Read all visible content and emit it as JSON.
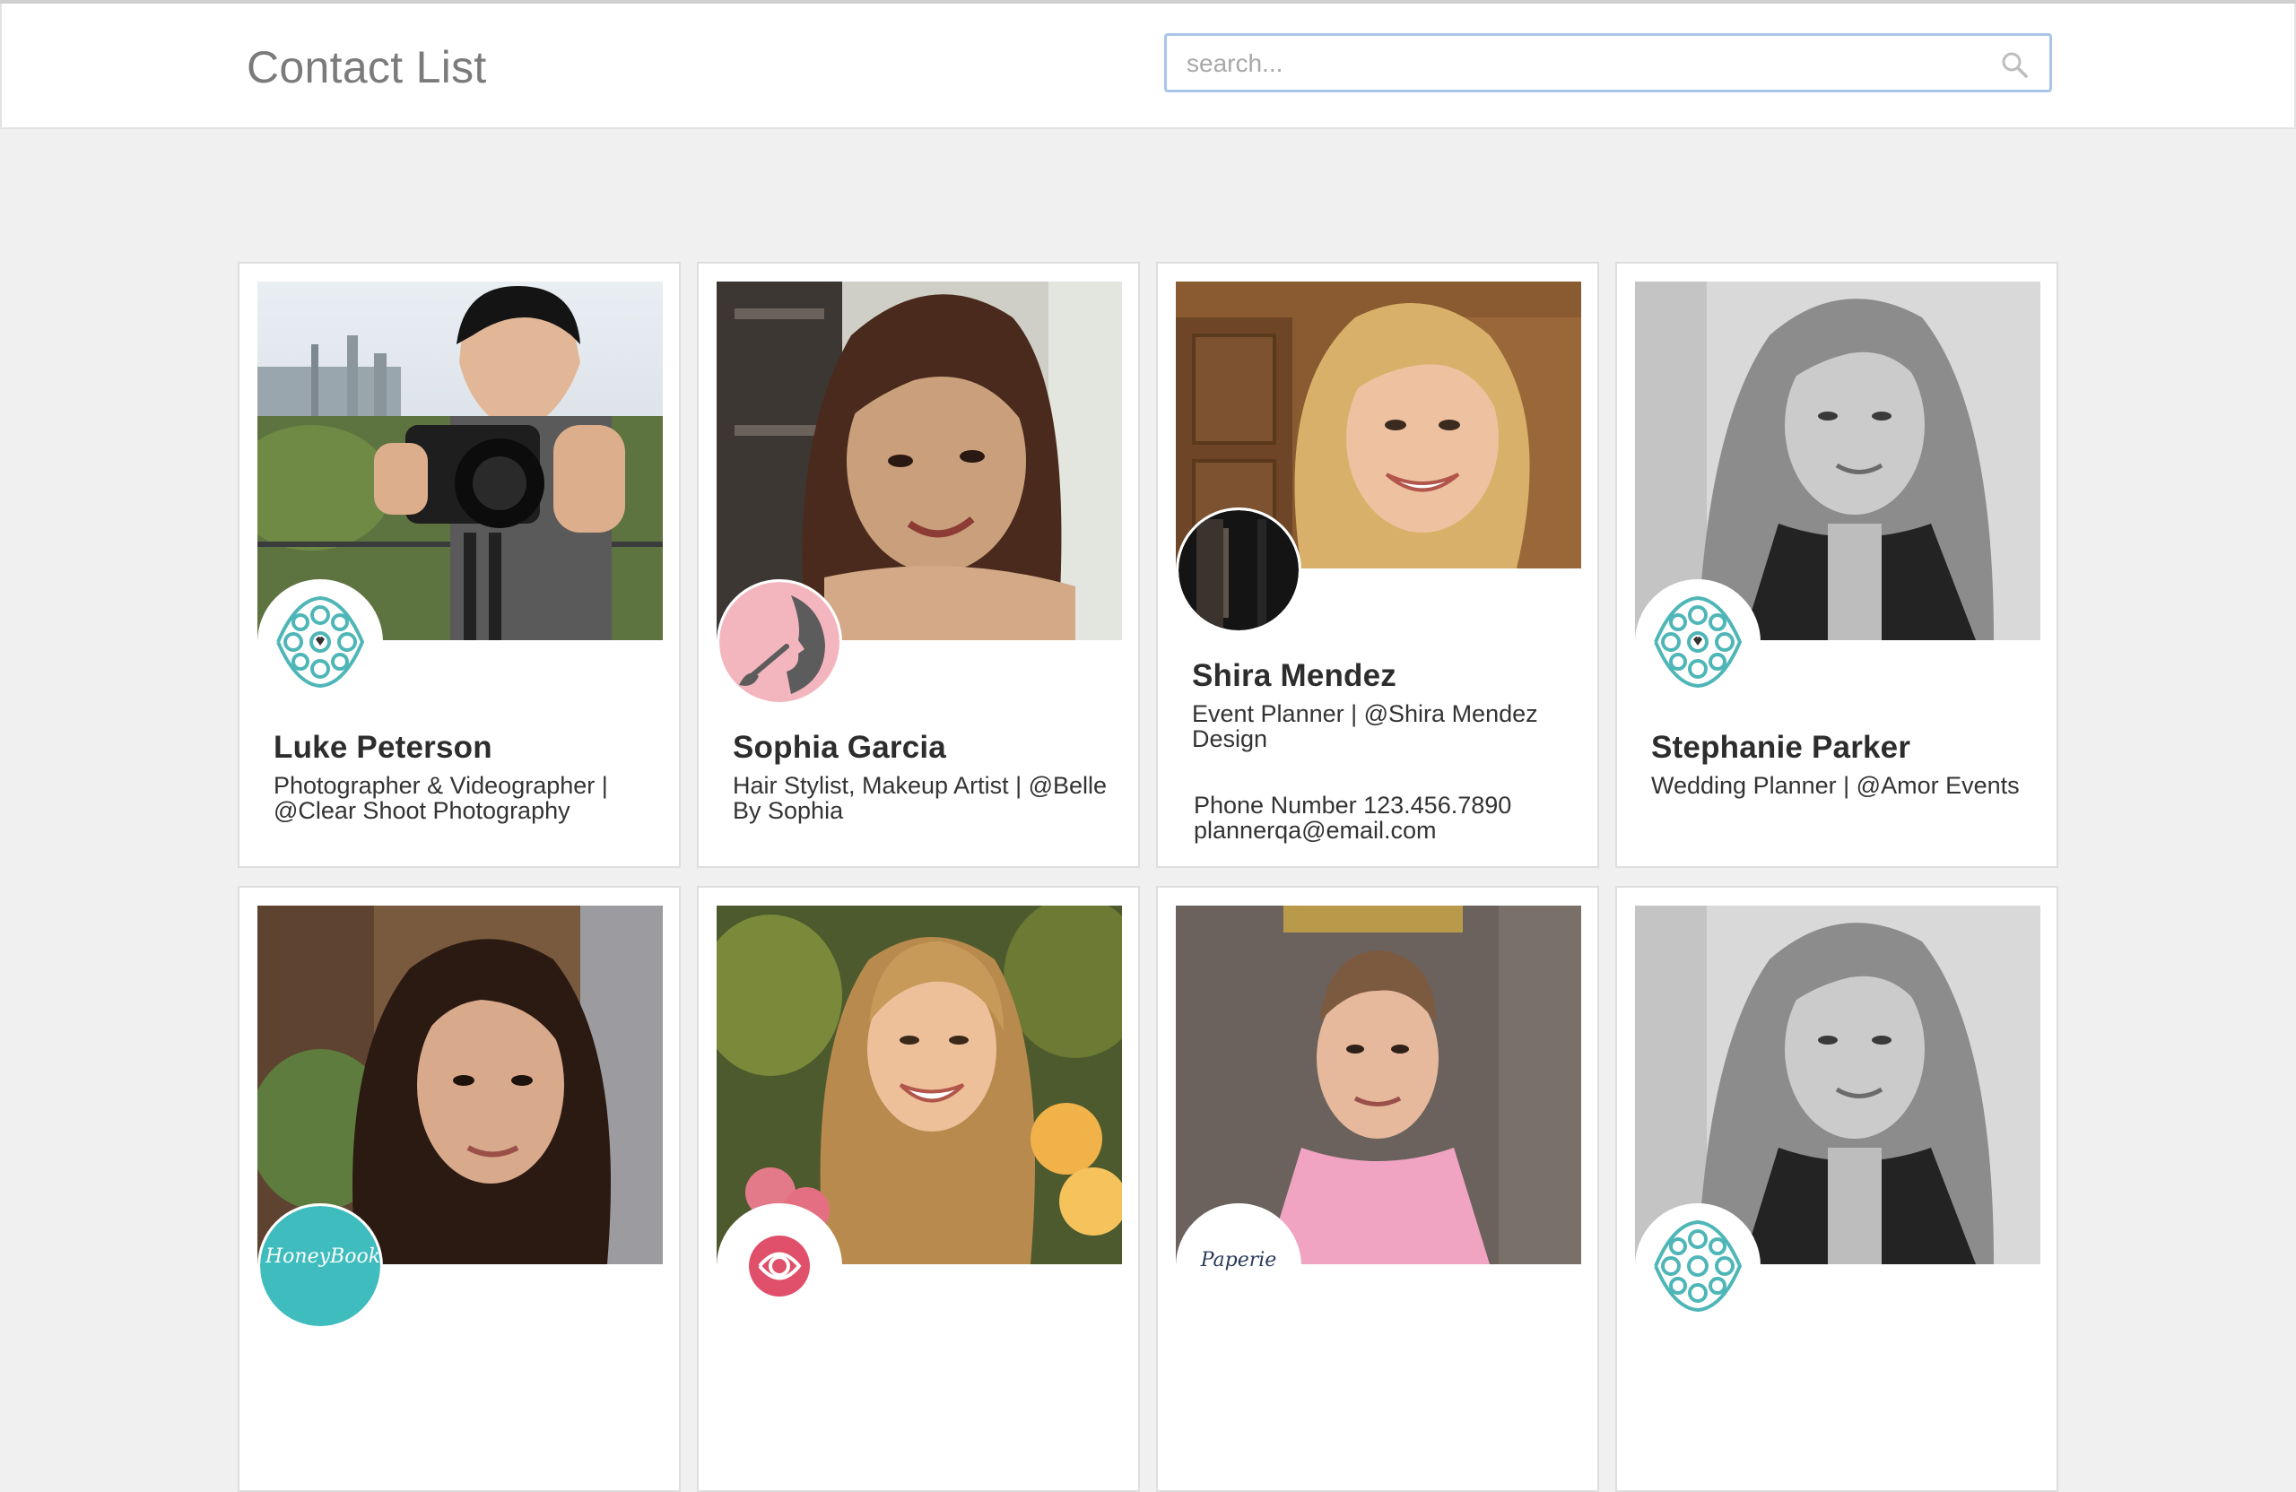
{
  "header": {
    "title": "Contact List",
    "search_placeholder": "search..."
  },
  "contacts": [
    {
      "name": "Luke Peterson",
      "role": "Photographer & Videographer | @Clear Shoot Photography",
      "logo": "teal-floral-logo"
    },
    {
      "name": "Sophia Garcia",
      "role": "Hair Stylist, Makeup Artist | @Belle By Sophia",
      "logo": "pink-makeup-logo"
    },
    {
      "name": "Shira Mendez",
      "role": "Event Planner | @Shira Mendez Design",
      "phone": "Phone Number 123.456.7890",
      "email": "plannerqa@email.com",
      "logo": "dark-door-logo"
    },
    {
      "name": "Stephanie Parker",
      "role": "Wedding Planner | @Amor Events",
      "logo": "teal-floral-logo"
    },
    {
      "logo": "honeybook-logo",
      "logo_text": "HoneyBook"
    },
    {
      "logo": "pink-rose-logo"
    },
    {
      "logo": "paperie-logo",
      "logo_text": "Paperie"
    },
    {
      "logo": "teal-floral-logo"
    }
  ],
  "colors": {
    "background": "#f0f0f0",
    "title": "#7b7b7b",
    "search_border": "#a9c5ea",
    "teal_logo": "#4fb6b8",
    "pink_logo": "#f4b6be"
  }
}
